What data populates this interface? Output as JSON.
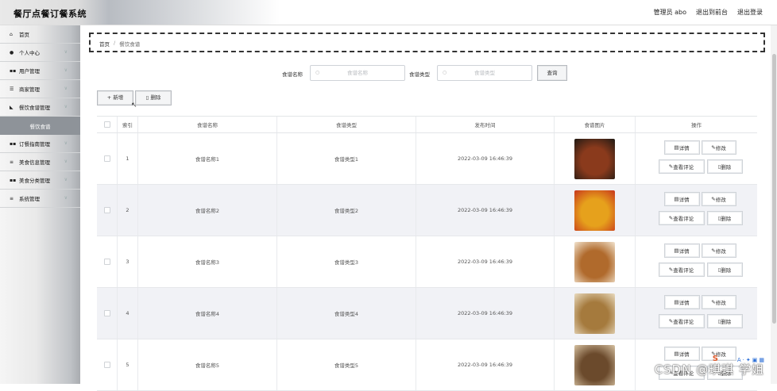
{
  "app": {
    "title": "餐厅点餐订餐系统"
  },
  "header": {
    "user": "管理员 abo",
    "front": "退出到前台",
    "logout": "退出登录"
  },
  "sidebar": {
    "items": [
      {
        "label": "首页",
        "icon": "home-icon",
        "glyph": "⌂",
        "chevron": false
      },
      {
        "label": "个人中心",
        "icon": "user-icon",
        "glyph": "●",
        "chevron": true
      },
      {
        "label": "用户管理",
        "icon": "grid-icon",
        "glyph": "▪▪",
        "chevron": true
      },
      {
        "label": "商家管理",
        "icon": "sliders-icon",
        "glyph": "☰",
        "chevron": true
      },
      {
        "label": "餐饮食谱管理",
        "icon": "thumb-icon",
        "glyph": "◣",
        "chevron": true
      }
    ],
    "active_sub": "餐饮食谱",
    "items2": [
      {
        "label": "订餐指南管理",
        "icon": "grid-icon",
        "glyph": "▪▪",
        "chevron": true
      },
      {
        "label": "美食信息管理",
        "icon": "list-icon",
        "glyph": "≡",
        "chevron": true
      },
      {
        "label": "美食分类管理",
        "icon": "grid-icon",
        "glyph": "▪▪",
        "chevron": true
      },
      {
        "label": "系统管理",
        "icon": "list-icon",
        "glyph": "≡",
        "chevron": true
      }
    ]
  },
  "breadcrumb": {
    "home": "首页",
    "sep": "/",
    "current": "餐饮食谱"
  },
  "search": {
    "name_label": "食谱名称",
    "name_placeholder": "食谱名称",
    "type_label": "食谱类型",
    "type_placeholder": "食谱类型",
    "query_label": "查询"
  },
  "toolbar": {
    "add_label": "+ 新增",
    "delete_label": "删除"
  },
  "table": {
    "headers": [
      "索引",
      "食谱名称",
      "食谱类型",
      "发布时间",
      "食谱图片",
      "操作"
    ],
    "rows": [
      {
        "index": "1",
        "name": "食谱名称1",
        "type": "食谱类型1",
        "time": "2022-03-09 16:46:39",
        "img": "#8a3a1c",
        "img2": "#1f1a14"
      },
      {
        "index": "2",
        "name": "食谱名称2",
        "type": "食谱类型2",
        "time": "2022-03-09 16:46:39",
        "img": "#e6a11c",
        "img2": "#c7361d"
      },
      {
        "index": "3",
        "name": "食谱名称3",
        "type": "食谱类型3",
        "time": "2022-03-09 16:46:39",
        "img": "#b06a2c",
        "img2": "#f2e4cf"
      },
      {
        "index": "4",
        "name": "食谱名称4",
        "type": "食谱类型4",
        "time": "2022-03-09 16:46:39",
        "img": "#a57a3d",
        "img2": "#e9dbc0"
      },
      {
        "index": "5",
        "name": "食谱名称5",
        "type": "食谱类型5",
        "time": "2022-03-09 16:46:39",
        "img": "#6b4a2c",
        "img2": "#d7c2a2"
      }
    ],
    "ops": {
      "detail": "详情",
      "edit": "修改",
      "comments": "查看评论",
      "delete": "删除"
    }
  },
  "watermark": "CSDN @琪琪 学姐",
  "ime_logo": "S"
}
